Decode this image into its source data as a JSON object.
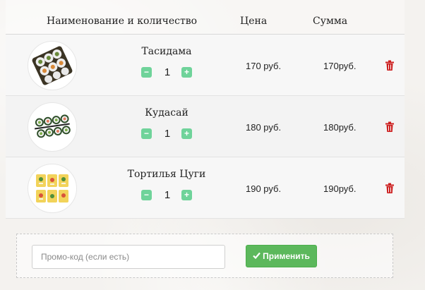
{
  "header": {
    "name_qty": "Наименование и количество",
    "price": "Цена",
    "sum": "Сумма"
  },
  "items": [
    {
      "name": "Тасидама",
      "qty": "1",
      "price": "170 руб.",
      "sum": "170руб.",
      "image": "roll-dark-seaweed"
    },
    {
      "name": "Кудасай",
      "qty": "1",
      "price": "180 руб.",
      "sum": "180руб.",
      "image": "roll-cucumber"
    },
    {
      "name": "Тортилья Цуги",
      "qty": "1",
      "price": "190 руб.",
      "sum": "190руб.",
      "image": "roll-tortilla"
    }
  ],
  "controls": {
    "minus": "−",
    "plus": "+"
  },
  "promo": {
    "placeholder": "Промо-код (если есть)",
    "apply_label": "Применить",
    "apply_icon": "check-icon"
  },
  "colors": {
    "qty_button": "#6fd39a",
    "apply_button": "#5cb85c",
    "trash": "#cc1f1f"
  }
}
